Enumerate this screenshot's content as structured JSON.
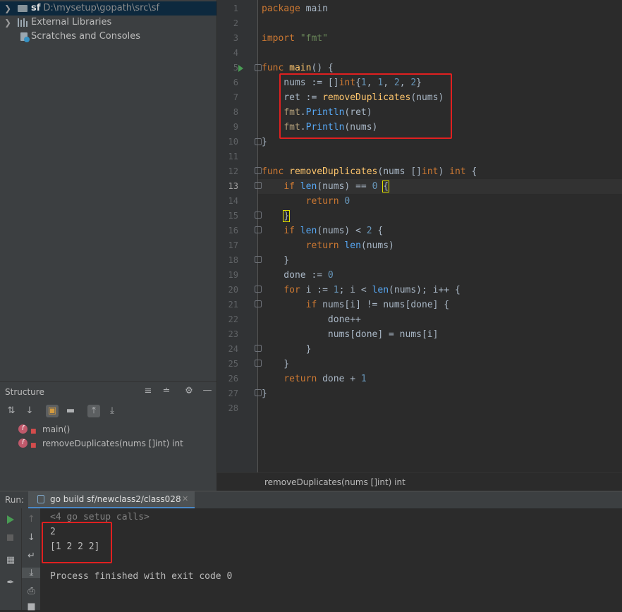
{
  "project_tree": {
    "root_name": "sf",
    "root_path": "D:\\mysetup\\gopath\\src\\sf",
    "external_libraries": "External Libraries",
    "scratches": "Scratches and Consoles"
  },
  "structure": {
    "title": "Structure",
    "items": [
      {
        "badge": "f",
        "label": "main()"
      },
      {
        "badge": "f",
        "label": "removeDuplicates(nums []int) int"
      }
    ]
  },
  "editor": {
    "line_numbers": [
      "1",
      "2",
      "3",
      "4",
      "5",
      "6",
      "7",
      "8",
      "9",
      "10",
      "11",
      "12",
      "13",
      "14",
      "15",
      "16",
      "17",
      "18",
      "19",
      "20",
      "21",
      "22",
      "23",
      "24",
      "25",
      "26",
      "27",
      "28"
    ],
    "current_line": "13",
    "breadcrumb": "removeDuplicates(nums []int) int",
    "code_lines": [
      "package main",
      "",
      "import \"fmt\"",
      "",
      "func main() {",
      "    nums := []int{1, 1, 2, 2}",
      "    ret := removeDuplicates(nums)",
      "    fmt.Println(ret)",
      "    fmt.Println(nums)",
      "}",
      "",
      "func removeDuplicates(nums []int) int {",
      "    if len(nums) == 0 {",
      "        return 0",
      "    }",
      "    if len(nums) < 2 {",
      "        return len(nums)",
      "    }",
      "    done := 0",
      "    for i := 1; i < len(nums); i++ {",
      "        if nums[i] != nums[done] {",
      "            done++",
      "            nums[done] = nums[i]",
      "        }",
      "    }",
      "    return done + 1",
      "}",
      ""
    ]
  },
  "run": {
    "label": "Run:",
    "tab_title": "go build sf/newclass2/class028",
    "output": [
      "<4 go setup calls>",
      "2",
      "[1 2 2 2]",
      "",
      "Process finished with exit code 0"
    ]
  },
  "colors": {
    "keyword": "#cc7832",
    "function": "#ffc66d",
    "string": "#6a8759",
    "number": "#6897bb",
    "highlight_box": "#e02020"
  }
}
